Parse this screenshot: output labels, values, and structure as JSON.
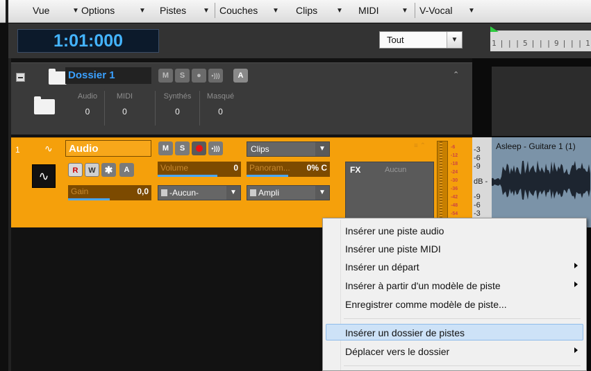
{
  "menubar": {
    "items": [
      {
        "label": "Vue",
        "has_dropdown": true
      },
      {
        "label": "Options",
        "has_dropdown": true
      },
      {
        "label": "Pistes",
        "has_dropdown": true
      },
      {
        "label": "Couches",
        "has_dropdown": true
      },
      {
        "label": "Clips",
        "has_dropdown": true
      },
      {
        "label": "MIDI",
        "has_dropdown": true
      },
      {
        "label": "V-Vocal",
        "has_dropdown": true
      }
    ]
  },
  "transport": {
    "time": "1:01:000"
  },
  "filter": {
    "selected": "Tout"
  },
  "ruler": {
    "text": "1 | | | 5 | | | 9 | | | 1"
  },
  "folder": {
    "name": "Dossier 1",
    "buttons": {
      "mute": "M",
      "solo": "S",
      "automation": "A"
    },
    "stats": [
      {
        "label": "Audio",
        "value": "0"
      },
      {
        "label": "MIDI",
        "value": "0"
      },
      {
        "label": "Synthés",
        "value": "0"
      },
      {
        "label": "Masqué",
        "value": "0"
      }
    ]
  },
  "track": {
    "number": "1",
    "name": "Audio",
    "buttons": {
      "mute": "M",
      "solo": "S",
      "read": "R",
      "write": "W",
      "automation": "A"
    },
    "view_mode": "Clips",
    "volume": {
      "label": "Volume",
      "value": "0",
      "fill_fraction": 0.72
    },
    "pan": {
      "label": "Panoram...",
      "value": "0% C",
      "fill_fraction": 0.5
    },
    "gain": {
      "label": "Gain",
      "value": "0,0",
      "fill_fraction": 0.5
    },
    "input": "-Aucun-",
    "output": "Ampli",
    "fx": {
      "label": "FX",
      "value": "Aucun"
    },
    "meter_scale": [
      "-6",
      "-12",
      "-18",
      "-24",
      "-30",
      "-36",
      "-42",
      "-48",
      "-54"
    ],
    "clip_db_scale": [
      "-3",
      "-6",
      "-9",
      "dB -",
      "-9",
      "-6",
      "-3"
    ],
    "clip_title": "Asleep - Guitare 1 (1)"
  },
  "context_menu": {
    "items": [
      {
        "label": "Insérer une piste audio",
        "submenu": false,
        "highlighted": false
      },
      {
        "label": "Insérer une piste MIDI",
        "submenu": false,
        "highlighted": false
      },
      {
        "label": "Insérer un départ",
        "submenu": true,
        "highlighted": false
      },
      {
        "label": "Insérer à partir d'un modèle de piste",
        "submenu": true,
        "highlighted": false
      },
      {
        "label": "Enregistrer comme modèle de piste...",
        "submenu": false,
        "highlighted": false
      },
      {
        "label": "Insérer un dossier de pistes",
        "submenu": false,
        "highlighted": true
      },
      {
        "label": "Déplacer vers le dossier",
        "submenu": true,
        "highlighted": false
      }
    ]
  },
  "colors": {
    "track_orange": "#f5a00b",
    "time_blue": "#44b4ff",
    "folder_name_blue": "#3aa0ff",
    "menu_highlight": "#cde2f7"
  }
}
